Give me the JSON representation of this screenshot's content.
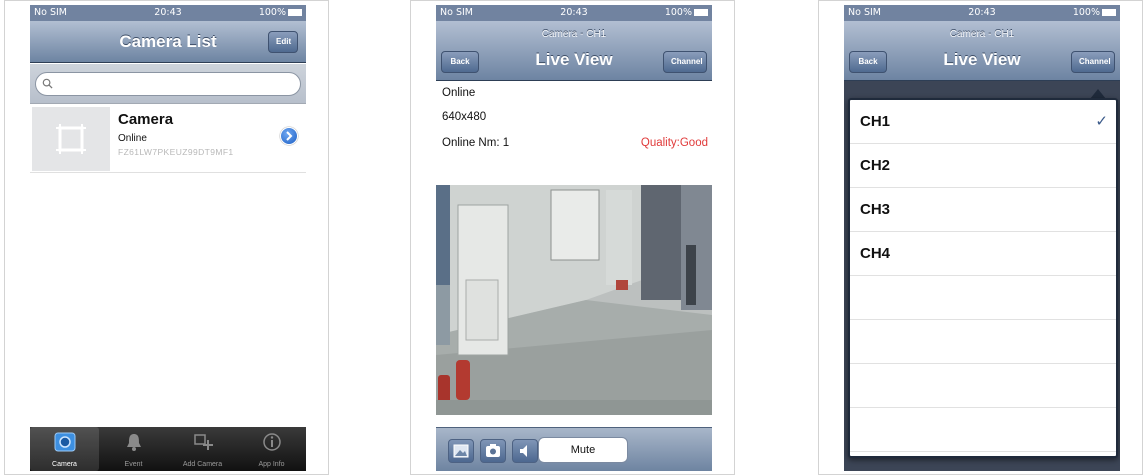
{
  "status_bar": {
    "carrier": "No SIM",
    "time": "20:43",
    "battery": "100%"
  },
  "screen1": {
    "title": "Camera List",
    "edit_label": "Edit",
    "search": {
      "placeholder": "",
      "value": ""
    },
    "cameras": [
      {
        "name": "Camera",
        "status": "Online",
        "uid": "FZ61LW7PKEUZ99DT9MF1"
      }
    ],
    "tabs": [
      {
        "label": "Camera",
        "icon": "camera-icon",
        "active": true
      },
      {
        "label": "Event",
        "icon": "bell-icon",
        "active": false
      },
      {
        "label": "Add Camera",
        "icon": "add-camera-icon",
        "active": false
      },
      {
        "label": "App Info",
        "icon": "info-icon",
        "active": false
      }
    ]
  },
  "screen2": {
    "subtitle": "Camera - CH1",
    "title": "Live View",
    "back_label": "Back",
    "channel_label": "Channel",
    "status": "Online",
    "resolution": "640x480",
    "online_count": "Online Nm: 1",
    "quality": "Quality:Good",
    "toolbar": {
      "icons": [
        "gallery-icon",
        "snapshot-icon",
        "speaker-icon"
      ],
      "mute_label": "Mute"
    }
  },
  "screen3": {
    "subtitle": "Camera - CH1",
    "title": "Live View",
    "back_label": "Back",
    "channel_label": "Channel",
    "channels": [
      {
        "label": "CH1",
        "selected": true
      },
      {
        "label": "CH2",
        "selected": false
      },
      {
        "label": "CH3",
        "selected": false
      },
      {
        "label": "CH4",
        "selected": false
      }
    ],
    "check_mark": "✓"
  },
  "colors": {
    "navbar": "#7186a4",
    "quality_text": "#e03a3a",
    "tabbar": "#1a1a1a",
    "dim_overlay": "#3c4556"
  }
}
